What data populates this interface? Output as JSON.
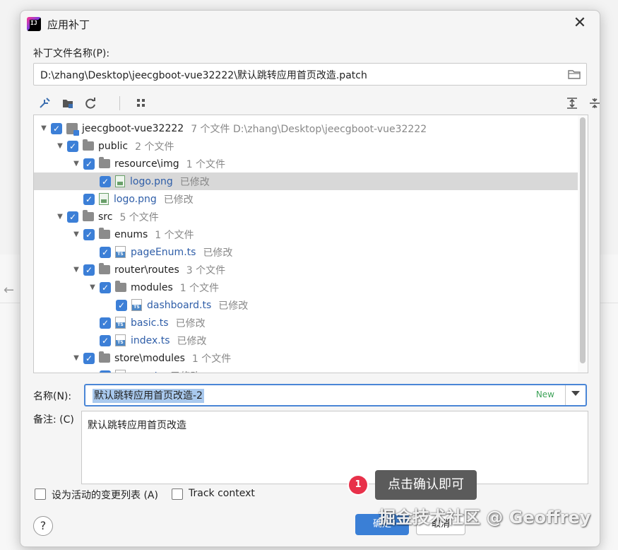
{
  "dialog": {
    "title": "应用补丁",
    "app_icon_text": "IJ"
  },
  "patch_file": {
    "label": "补丁文件名称(P):",
    "value": "D:\\zhang\\Desktop\\jeecgboot-vue32222\\默认跳转应用首页改造.patch"
  },
  "toolbar": {
    "icons": [
      "merge-icon",
      "folder-map-icon",
      "refresh-icon",
      "group-icon",
      "expand-all-icon",
      "collapse-all-icon"
    ]
  },
  "tree": {
    "rows": [
      {
        "level": 0,
        "arrow": "▼",
        "type": "project",
        "name": "jeecgboot-vue32222",
        "meta": "7 个文件  D:\\zhang\\Desktop\\jeecgboot-vue32222",
        "modified": false
      },
      {
        "level": 1,
        "arrow": "▼",
        "type": "folder",
        "name": "public",
        "meta": "2 个文件",
        "modified": false
      },
      {
        "level": 2,
        "arrow": "▼",
        "type": "folder",
        "name": "resource\\img",
        "meta": "1 个文件",
        "modified": false
      },
      {
        "level": 3,
        "arrow": "",
        "type": "image",
        "name": "logo.png",
        "meta": "已修改",
        "modified": true,
        "selected": true
      },
      {
        "level": 2,
        "arrow": "",
        "type": "image",
        "name": "logo.png",
        "meta": "已修改",
        "modified": true
      },
      {
        "level": 1,
        "arrow": "▼",
        "type": "folder",
        "name": "src",
        "meta": "5 个文件",
        "modified": false
      },
      {
        "level": 2,
        "arrow": "▼",
        "type": "folder",
        "name": "enums",
        "meta": "1 个文件",
        "modified": false
      },
      {
        "level": 3,
        "arrow": "",
        "type": "ts",
        "name": "pageEnum.ts",
        "meta": "已修改",
        "modified": true
      },
      {
        "level": 2,
        "arrow": "▼",
        "type": "folder",
        "name": "router\\routes",
        "meta": "3 个文件",
        "modified": false
      },
      {
        "level": 3,
        "arrow": "▼",
        "type": "folder",
        "name": "modules",
        "meta": "1 个文件",
        "modified": false
      },
      {
        "level": 4,
        "arrow": "",
        "type": "ts",
        "name": "dashboard.ts",
        "meta": "已修改",
        "modified": true
      },
      {
        "level": 3,
        "arrow": "",
        "type": "ts",
        "name": "basic.ts",
        "meta": "已修改",
        "modified": true
      },
      {
        "level": 3,
        "arrow": "",
        "type": "ts",
        "name": "index.ts",
        "meta": "已修改",
        "modified": true
      },
      {
        "level": 2,
        "arrow": "▼",
        "type": "folder",
        "name": "store\\modules",
        "meta": "1 个文件",
        "modified": false
      },
      {
        "level": 3,
        "arrow": "",
        "type": "ts",
        "name": "user.ts",
        "meta": "已修改",
        "modified": true
      }
    ]
  },
  "name_field": {
    "label": "名称(N):",
    "value": "默认跳转应用首页改造-2",
    "badge": "New"
  },
  "comment_field": {
    "label": "备注: (C)",
    "value": "默认跳转应用首页改造"
  },
  "options": {
    "active_changelist_label": "设为活动的变更列表 (A)",
    "track_context_label": "Track context"
  },
  "buttons": {
    "ok": "确定",
    "cancel": "取消",
    "help": "?"
  },
  "annotation": {
    "step": "1",
    "tooltip": "点击确认即可"
  },
  "watermark": "掘金技术社区 @ Geoffrey",
  "colors": {
    "accent": "#3c7fd7",
    "modified_text": "#2f5ea8",
    "new_badge": "#3fa35a",
    "step_badge": "#e8314a"
  }
}
